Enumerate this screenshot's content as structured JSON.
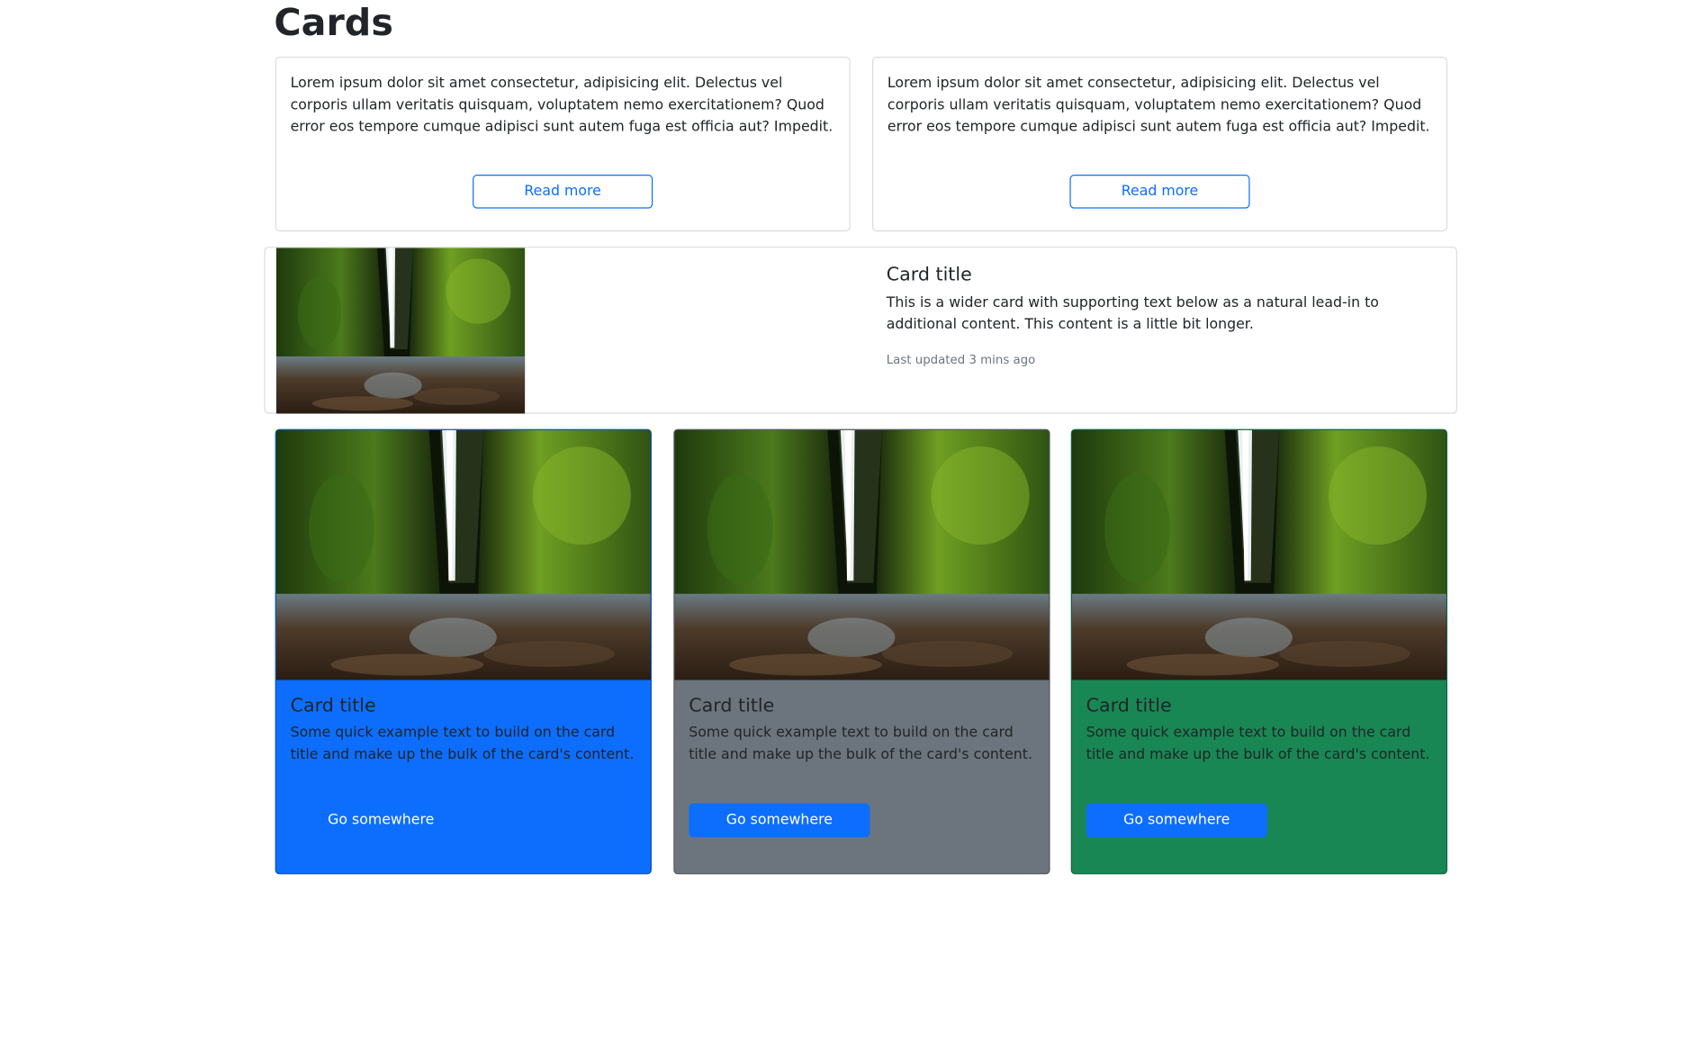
{
  "page": {
    "heading": "Cards"
  },
  "text_cards": [
    {
      "text": "Lorem ipsum dolor sit amet consectetur, adipisicing elit. Delectus vel corporis ullam veritatis quisquam, voluptatem nemo exercitationem? Quod error eos tempore cumque adipisci sunt autem fuga est officia aut? Impedit.",
      "button": "Read more"
    },
    {
      "text": "Lorem ipsum dolor sit amet consectetur, adipisicing elit. Delectus vel corporis ullam veritatis quisquam, voluptatem nemo exercitationem? Quod error eos tempore cumque adipisci sunt autem fuga est officia aut? Impedit.",
      "button": "Read more"
    }
  ],
  "wide_card": {
    "title": "Card title",
    "text": "This is a wider card with supporting text below as a natural lead-in to additional content. This content is a little bit longer.",
    "meta": "Last updated 3 mins ago"
  },
  "color_cards": [
    {
      "title": "Card title",
      "text": "Some quick example text to build on the card title and make up the bulk of the card's content.",
      "button": "Go somewhere",
      "bg_color": "#0d6efd"
    },
    {
      "title": "Card title",
      "text": "Some quick example text to build on the card title and make up the bulk of the card's content.",
      "button": "Go somewhere",
      "bg_color": "#6c757d"
    },
    {
      "title": "Card title",
      "text": "Some quick example text to build on the card title and make up the bulk of the card's content.",
      "button": "Go somewhere",
      "bg_color": "#198754"
    }
  ],
  "colors": {
    "primary": "#0d6efd",
    "border": "#dcdcdc",
    "muted": "#6c757d"
  },
  "image": {
    "subject": "waterfall-photo"
  }
}
